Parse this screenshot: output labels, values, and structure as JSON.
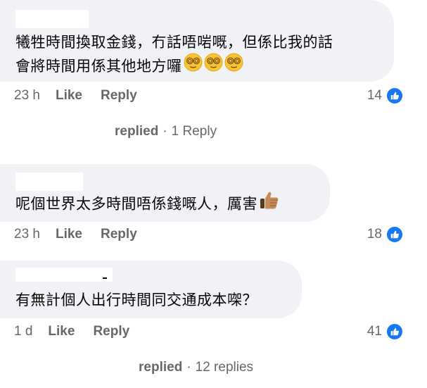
{
  "comments": [
    {
      "text": "犧牲時間換取金錢，冇話唔啱嘅，但係比我的話",
      "text_line2": "會將時間用係其他地方囉",
      "emoji": "face-with-spiral-eyes-icon",
      "time": "23 h",
      "like_label": "Like",
      "reply_label": "Reply",
      "reaction_count": "14"
    },
    {
      "text": "呢個世界太多時間唔係錢嘅人，厲害",
      "emoji": "thumbs-up-medium-skin-icon",
      "time": "23 h",
      "like_label": "Like",
      "reply_label": "Reply",
      "reaction_count": "18"
    },
    {
      "text": "有無計個人出行時間同交通成本㗎？",
      "time": "1 d",
      "like_label": "Like",
      "reply_label": "Reply",
      "reaction_count": "41"
    }
  ],
  "replies": [
    {
      "lead": "replied",
      "separator": "·",
      "count_text": "1 Reply"
    },
    {
      "lead": "replied",
      "separator": "·",
      "count_text": "12 replies"
    }
  ],
  "colors": {
    "bubble_bg": "#f0f2f5",
    "meta_text": "#65676b",
    "like_badge": "#1877f2"
  }
}
